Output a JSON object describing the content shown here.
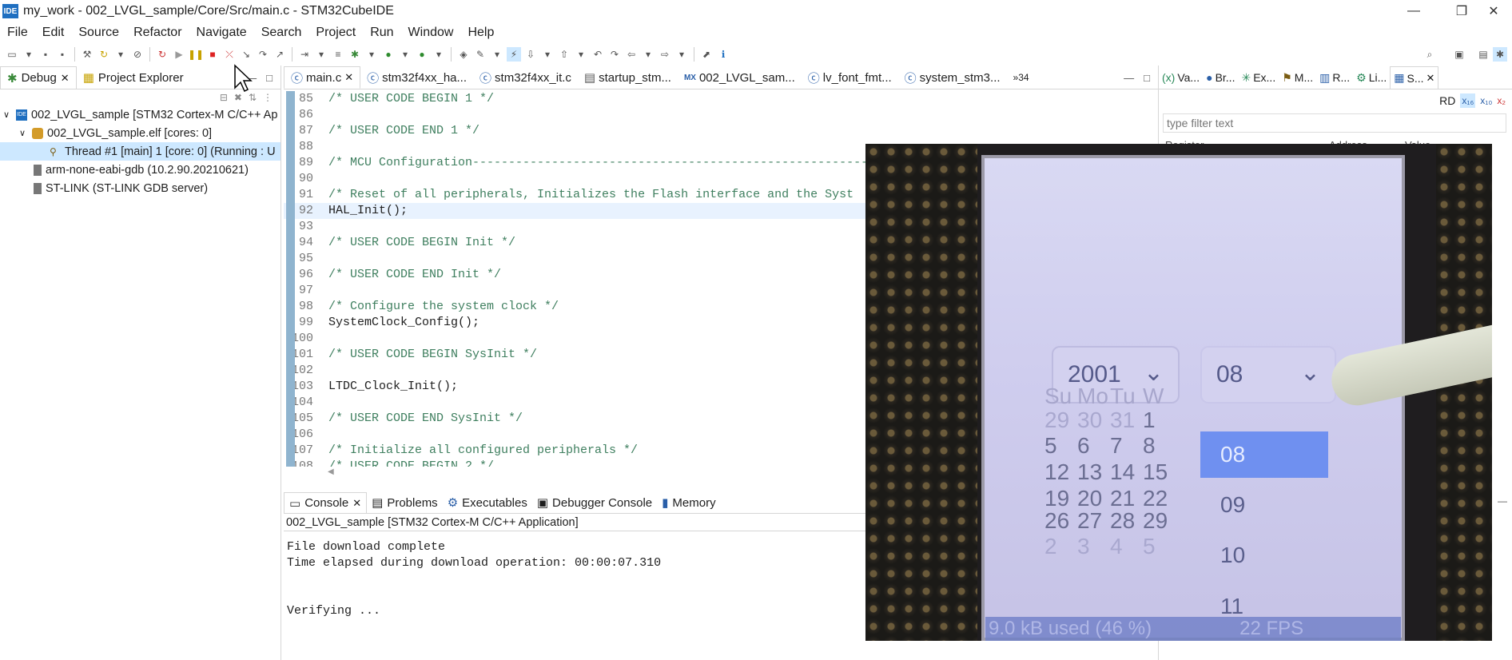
{
  "window": {
    "title": "my_work - 002_LVGL_sample/Core/Src/main.c - STM32CubeIDE",
    "app_icon": "IDE",
    "controls": {
      "minimize": "—",
      "restore": "❐",
      "close": "✕"
    }
  },
  "menu": [
    "File",
    "Edit",
    "Source",
    "Refactor",
    "Navigate",
    "Search",
    "Project",
    "Run",
    "Window",
    "Help"
  ],
  "left_view": {
    "tabs": [
      "Debug",
      "Project Explorer"
    ],
    "tree": [
      {
        "label": "002_LVGL_sample [STM32 Cortex-M C/C++ Ap",
        "level": 0,
        "toggle": "∨"
      },
      {
        "label": "002_LVGL_sample.elf [cores: 0]",
        "level": 1,
        "toggle": "∨"
      },
      {
        "label": "Thread #1 [main] 1 [core: 0] (Running : U",
        "level": 2,
        "toggle": ""
      },
      {
        "label": "arm-none-eabi-gdb (10.2.90.20210621)",
        "level": 1,
        "toggle": ""
      },
      {
        "label": "ST-LINK (ST-LINK GDB server)",
        "level": 1,
        "toggle": ""
      }
    ]
  },
  "editor": {
    "tabs": [
      "main.c",
      "stm32f4xx_ha...",
      "stm32f4xx_it.c",
      "startup_stm...",
      "002_LVGL_sam...",
      "lv_font_fmt...",
      "system_stm3...",
      "»34"
    ],
    "lines": [
      {
        "n": "85",
        "t": "/* USER CODE BEGIN 1 */"
      },
      {
        "n": "86",
        "t": ""
      },
      {
        "n": "87",
        "t": "/* USER CODE END 1 */"
      },
      {
        "n": "88",
        "t": ""
      },
      {
        "n": "89",
        "t": "/* MCU Configuration--------------------------------------------------------"
      },
      {
        "n": "90",
        "t": ""
      },
      {
        "n": "91",
        "t": "/* Reset of all peripherals, Initializes the Flash interface and the Syst"
      },
      {
        "n": "92",
        "t": "HAL_Init();"
      },
      {
        "n": "93",
        "t": ""
      },
      {
        "n": "94",
        "t": "/* USER CODE BEGIN Init */"
      },
      {
        "n": "95",
        "t": ""
      },
      {
        "n": "96",
        "t": "/* USER CODE END Init */"
      },
      {
        "n": "97",
        "t": ""
      },
      {
        "n": "98",
        "t": "/* Configure the system clock */"
      },
      {
        "n": "99",
        "t": "SystemClock_Config();"
      },
      {
        "n": "100",
        "t": ""
      },
      {
        "n": "101",
        "t": "/* USER CODE BEGIN SysInit */"
      },
      {
        "n": "102",
        "t": ""
      },
      {
        "n": "103",
        "t": "LTDC_Clock_Init();"
      },
      {
        "n": "104",
        "t": ""
      },
      {
        "n": "105",
        "t": "/* USER CODE END SysInit */"
      },
      {
        "n": "106",
        "t": ""
      },
      {
        "n": "107",
        "t": "/* Initialize all configured peripherals */"
      },
      {
        "n": "108",
        "t": "/* USER CODE BEGIN 2 */"
      }
    ]
  },
  "console": {
    "tabs": [
      "Console",
      "Problems",
      "Executables",
      "Debugger Console",
      "Memory"
    ],
    "session": "002_LVGL_sample [STM32 Cortex-M C/C++ Application]",
    "lines": [
      "File download complete",
      "Time elapsed during download operation: 00:00:07.310",
      "",
      "",
      "Verifying ..."
    ]
  },
  "right_view": {
    "tabs": [
      "Va...",
      "Br...",
      "Ex...",
      "M...",
      "R...",
      "Li...",
      "S..."
    ],
    "rd_label": "RD",
    "filter_placeholder": "type filter text",
    "columns": [
      "Register",
      "Address",
      "Value"
    ]
  },
  "photo": {
    "year": "2001",
    "month": "08",
    "weekdays": [
      "Su",
      "Mo",
      "Tu",
      "W"
    ],
    "days": [
      [
        "29",
        "30",
        "31",
        "1"
      ],
      [
        "5",
        "6",
        "7",
        "8"
      ],
      [
        "12",
        "13",
        "14",
        "15"
      ],
      [
        "19",
        "20",
        "21",
        "22"
      ],
      [
        "26",
        "27",
        "28",
        "29"
      ],
      [
        "2",
        "3",
        "4",
        "5"
      ]
    ],
    "options": [
      "08",
      "09",
      "10",
      "11"
    ],
    "status_left": "9.0 kB used (46 %)",
    "status_right": "22 FPS"
  },
  "colors": {
    "accent": "#1f6fc0",
    "selection": "#cde8ff",
    "comment": "#3f7f5f",
    "lcd_highlight": "#6f90f0"
  }
}
